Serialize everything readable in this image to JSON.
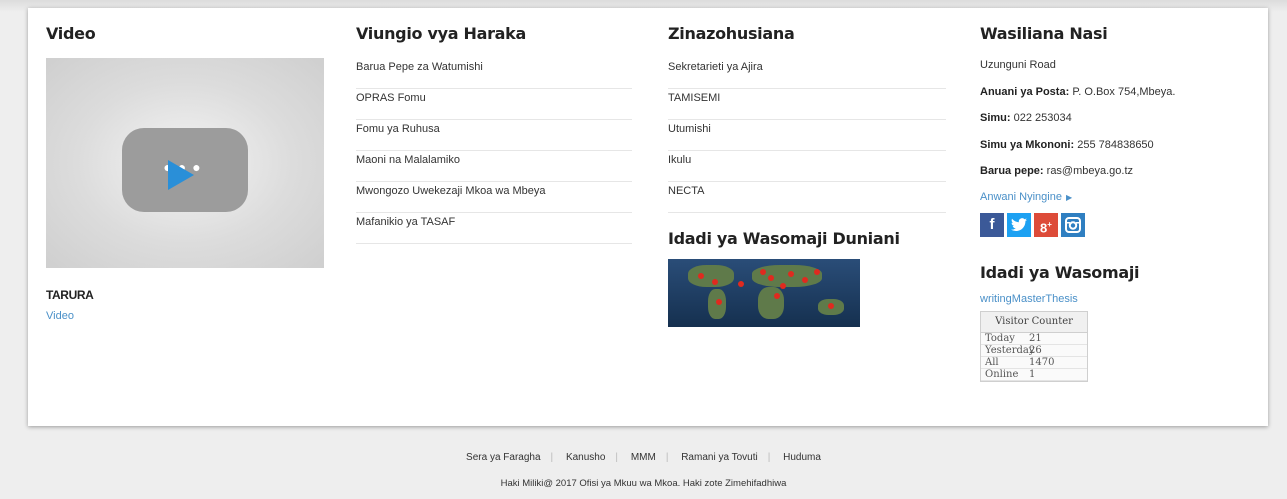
{
  "video": {
    "title": "Video",
    "thumbnail_icons": [
      "youtube-play-icon"
    ],
    "caption": "TARURA",
    "link": "Video"
  },
  "quick_links": {
    "title": "Viungio vya Haraka",
    "items": [
      "Barua Pepe za Watumishi",
      "OPRAS Fomu",
      "Fomu ya Ruhusa",
      "Maoni na Malalamiko",
      "Mwongozo Uwekezaji Mkoa wa Mbeya",
      "Mafanikio ya TASAF"
    ]
  },
  "related": {
    "title": "Zinazohusiana",
    "items": [
      "Sekretarieti ya Ajira",
      "TAMISEMI",
      "Utumishi",
      "Ikulu",
      "NECTA"
    ],
    "world_title": "Idadi ya Wasomaji Duniani"
  },
  "contact": {
    "title": "Wasiliana Nasi",
    "address": "Uzunguni Road",
    "postal_label": "Anuani ya Posta",
    "postal_value": "P. O.Box 754,Mbeya.",
    "phone_label": "Simu",
    "phone_value": "022 253034",
    "mobile_label": "Simu ya Mkononi",
    "mobile_value": "255 784838650",
    "email_label": "Barua pepe",
    "email_value": "ras@mbeya.go.tz",
    "more_link": "Anwani Nyingine",
    "social": [
      {
        "name": "facebook-icon",
        "glyph": "f",
        "color": "#3b5998"
      },
      {
        "name": "twitter-icon",
        "glyph": "t",
        "color": "#1da1f2"
      },
      {
        "name": "google-plus-icon",
        "glyph": "g+",
        "color": "#dd4b39"
      },
      {
        "name": "instagram-icon",
        "glyph": "ig",
        "color": "#2f7fc1"
      }
    ]
  },
  "readers": {
    "title": "Idadi ya Wasomaji",
    "site_link": "writingMasterThesis",
    "counter_title": "Visitor Counter",
    "rows": [
      {
        "label": "Today",
        "value": "21"
      },
      {
        "label": "Yesterday",
        "value": "26"
      },
      {
        "label": "All",
        "value": "1470"
      },
      {
        "label": "Online",
        "value": "1"
      }
    ]
  },
  "footer": {
    "links": [
      "Sera ya Faragha",
      "Kanusho",
      "MMM",
      "Ramani ya Tovuti",
      "Huduma"
    ],
    "copyright": "Haki Miliki@ 2017 Ofisi ya Mkuu wa Mkoa. Haki zote Zimehifadhiwa"
  }
}
